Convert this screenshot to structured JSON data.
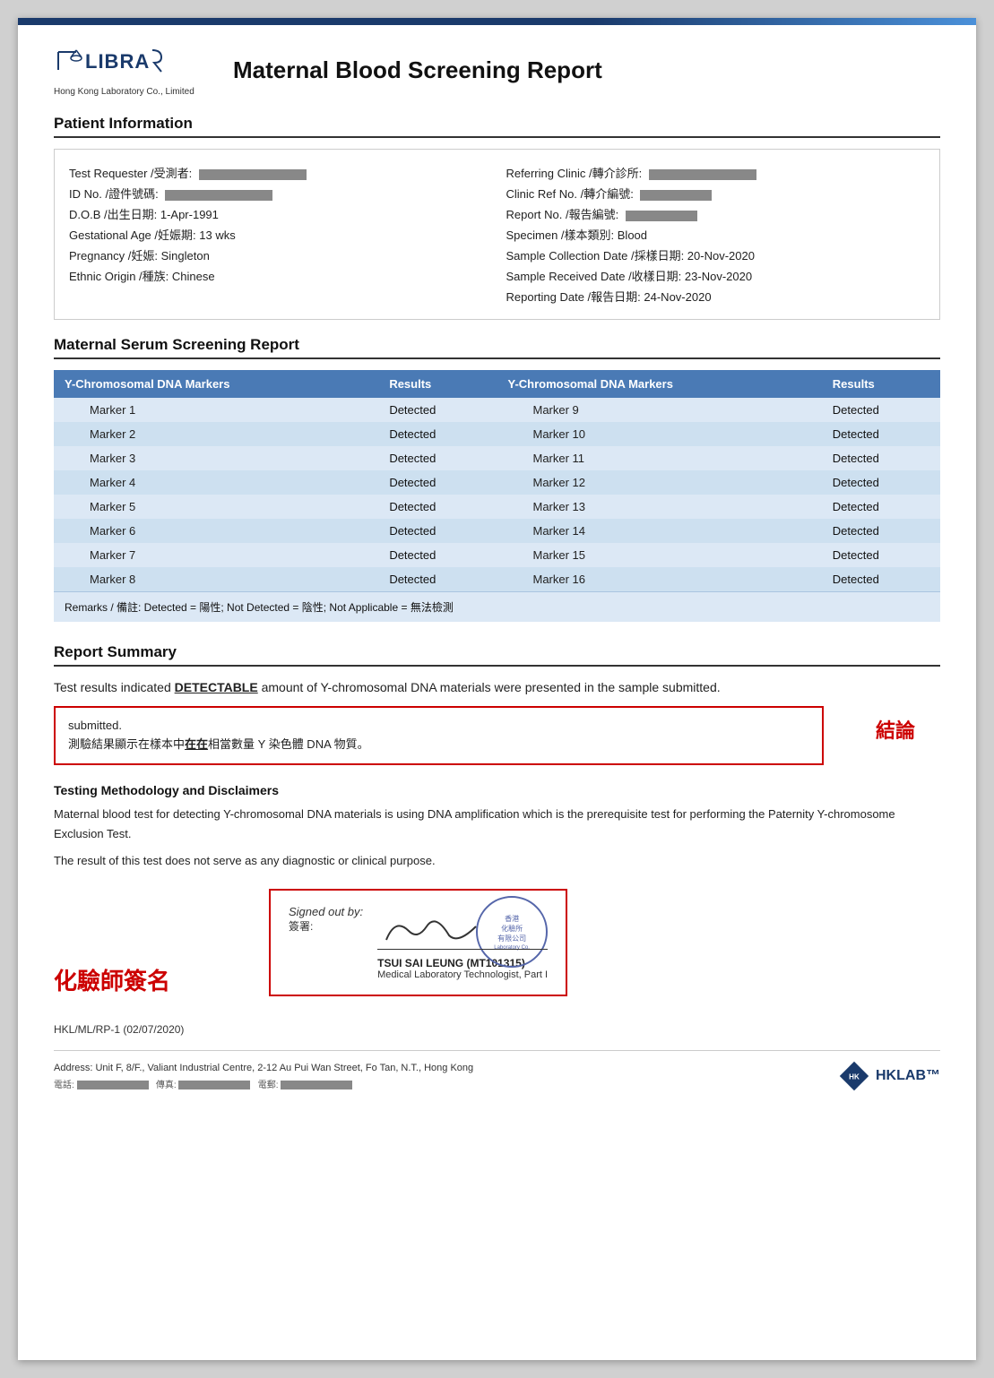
{
  "page": {
    "top_bar_color": "#1a3a6b",
    "logo": {
      "text": "LIBRA",
      "sub": "Hong Kong Laboratory Co., Limited"
    },
    "report_title": "Maternal Blood Screening Report"
  },
  "patient_info": {
    "section_title": "Patient Information",
    "left": [
      {
        "label": "Test Requester /受測者:",
        "value": "REDACTED"
      },
      {
        "label": "ID No. /證件號碼:",
        "value": "REDACTED"
      },
      {
        "label": "D.O.B /出生日期:",
        "value": "1-Apr-1991"
      },
      {
        "label": "Gestational Age /妊娠期:",
        "value": "13 wks"
      },
      {
        "label": "Pregnancy /妊娠:",
        "value": "Singleton"
      },
      {
        "label": "Ethnic Origin /種族:",
        "value": "Chinese"
      }
    ],
    "right": [
      {
        "label": "Referring Clinic /轉介診所:",
        "value": "REDACTED"
      },
      {
        "label": "Clinic Ref No. /轉介編號:",
        "value": "REDACTED"
      },
      {
        "label": "Report No. /報告編號:",
        "value": "REDACTED"
      },
      {
        "label": "Specimen /樣本類別:",
        "value": "Blood"
      },
      {
        "label": "Sample Collection Date /採樣日期:",
        "value": "20-Nov-2020"
      },
      {
        "label": "Sample Received Date /收樣日期:",
        "value": "23-Nov-2020"
      },
      {
        "label": "Reporting Date /報告日期:",
        "value": "24-Nov-2020"
      }
    ]
  },
  "serum": {
    "section_title": "Maternal Serum Screening Report",
    "col1_header": "Y-Chromosomal DNA Markers",
    "col2_header": "Results",
    "col3_header": "Y-Chromosomal DNA Markers",
    "col4_header": "Results",
    "left_markers": [
      {
        "marker": "Marker 1",
        "result": "Detected"
      },
      {
        "marker": "Marker 2",
        "result": "Detected"
      },
      {
        "marker": "Marker 3",
        "result": "Detected"
      },
      {
        "marker": "Marker 4",
        "result": "Detected"
      },
      {
        "marker": "Marker 5",
        "result": "Detected"
      },
      {
        "marker": "Marker 6",
        "result": "Detected"
      },
      {
        "marker": "Marker 7",
        "result": "Detected"
      },
      {
        "marker": "Marker 8",
        "result": "Detected"
      }
    ],
    "right_markers": [
      {
        "marker": "Marker 9",
        "result": "Detected"
      },
      {
        "marker": "Marker 10",
        "result": "Detected"
      },
      {
        "marker": "Marker 11",
        "result": "Detected"
      },
      {
        "marker": "Marker 12",
        "result": "Detected"
      },
      {
        "marker": "Marker 13",
        "result": "Detected"
      },
      {
        "marker": "Marker 14",
        "result": "Detected"
      },
      {
        "marker": "Marker 15",
        "result": "Detected"
      },
      {
        "marker": "Marker 16",
        "result": "Detected"
      }
    ],
    "remarks": "Remarks / 備註: Detected = 陽性; Not Detected = 陰性; Not Applicable = 無法檢測"
  },
  "report_summary": {
    "section_title": "Report Summary",
    "summary_text_1": "Test results indicated ",
    "summary_highlight": "DETECTABLE",
    "summary_text_2": " amount of Y-chromosomal DNA materials were presented in the sample submitted.",
    "conclusion_box_en": "submitted.",
    "conclusion_box_zh": "測驗結果顯示在樣本中在在相當數量 Y 染色體 DNA 物質。",
    "conclusion_zh_label": "結論"
  },
  "methodology": {
    "title": "Testing Methodology and Disclaimers",
    "text1": "Maternal blood test for detecting Y-chromosomal DNA materials is using DNA amplification which is the prerequisite test for performing the Paternity Y-chromosome Exclusion Test.",
    "text2": "The result of this test does not serve as any diagnostic or clinical purpose."
  },
  "signature": {
    "chemist_label": "化驗師簽名",
    "signed_out_by": "Signed out by:",
    "signed_chinese": "簽署:",
    "name": "TSUI SAI LEUNG (MT101315)",
    "title": "Medical Laboratory Technologist, Part I",
    "stamp_text": "香港\n化驗所\n有限公司"
  },
  "doc_ref": {
    "text": "HKL/ML/RP-1 (02/07/2020)"
  },
  "footer": {
    "address": "Address: Unit F, 8/F., Valiant Industrial Centre, 2-12 Au Pui Wan Street, Fo Tan, N.T., Hong Kong",
    "contacts": "電話: (REDACTED)    傳真: (REDACTED)    電郵: (REDACTED)"
  }
}
